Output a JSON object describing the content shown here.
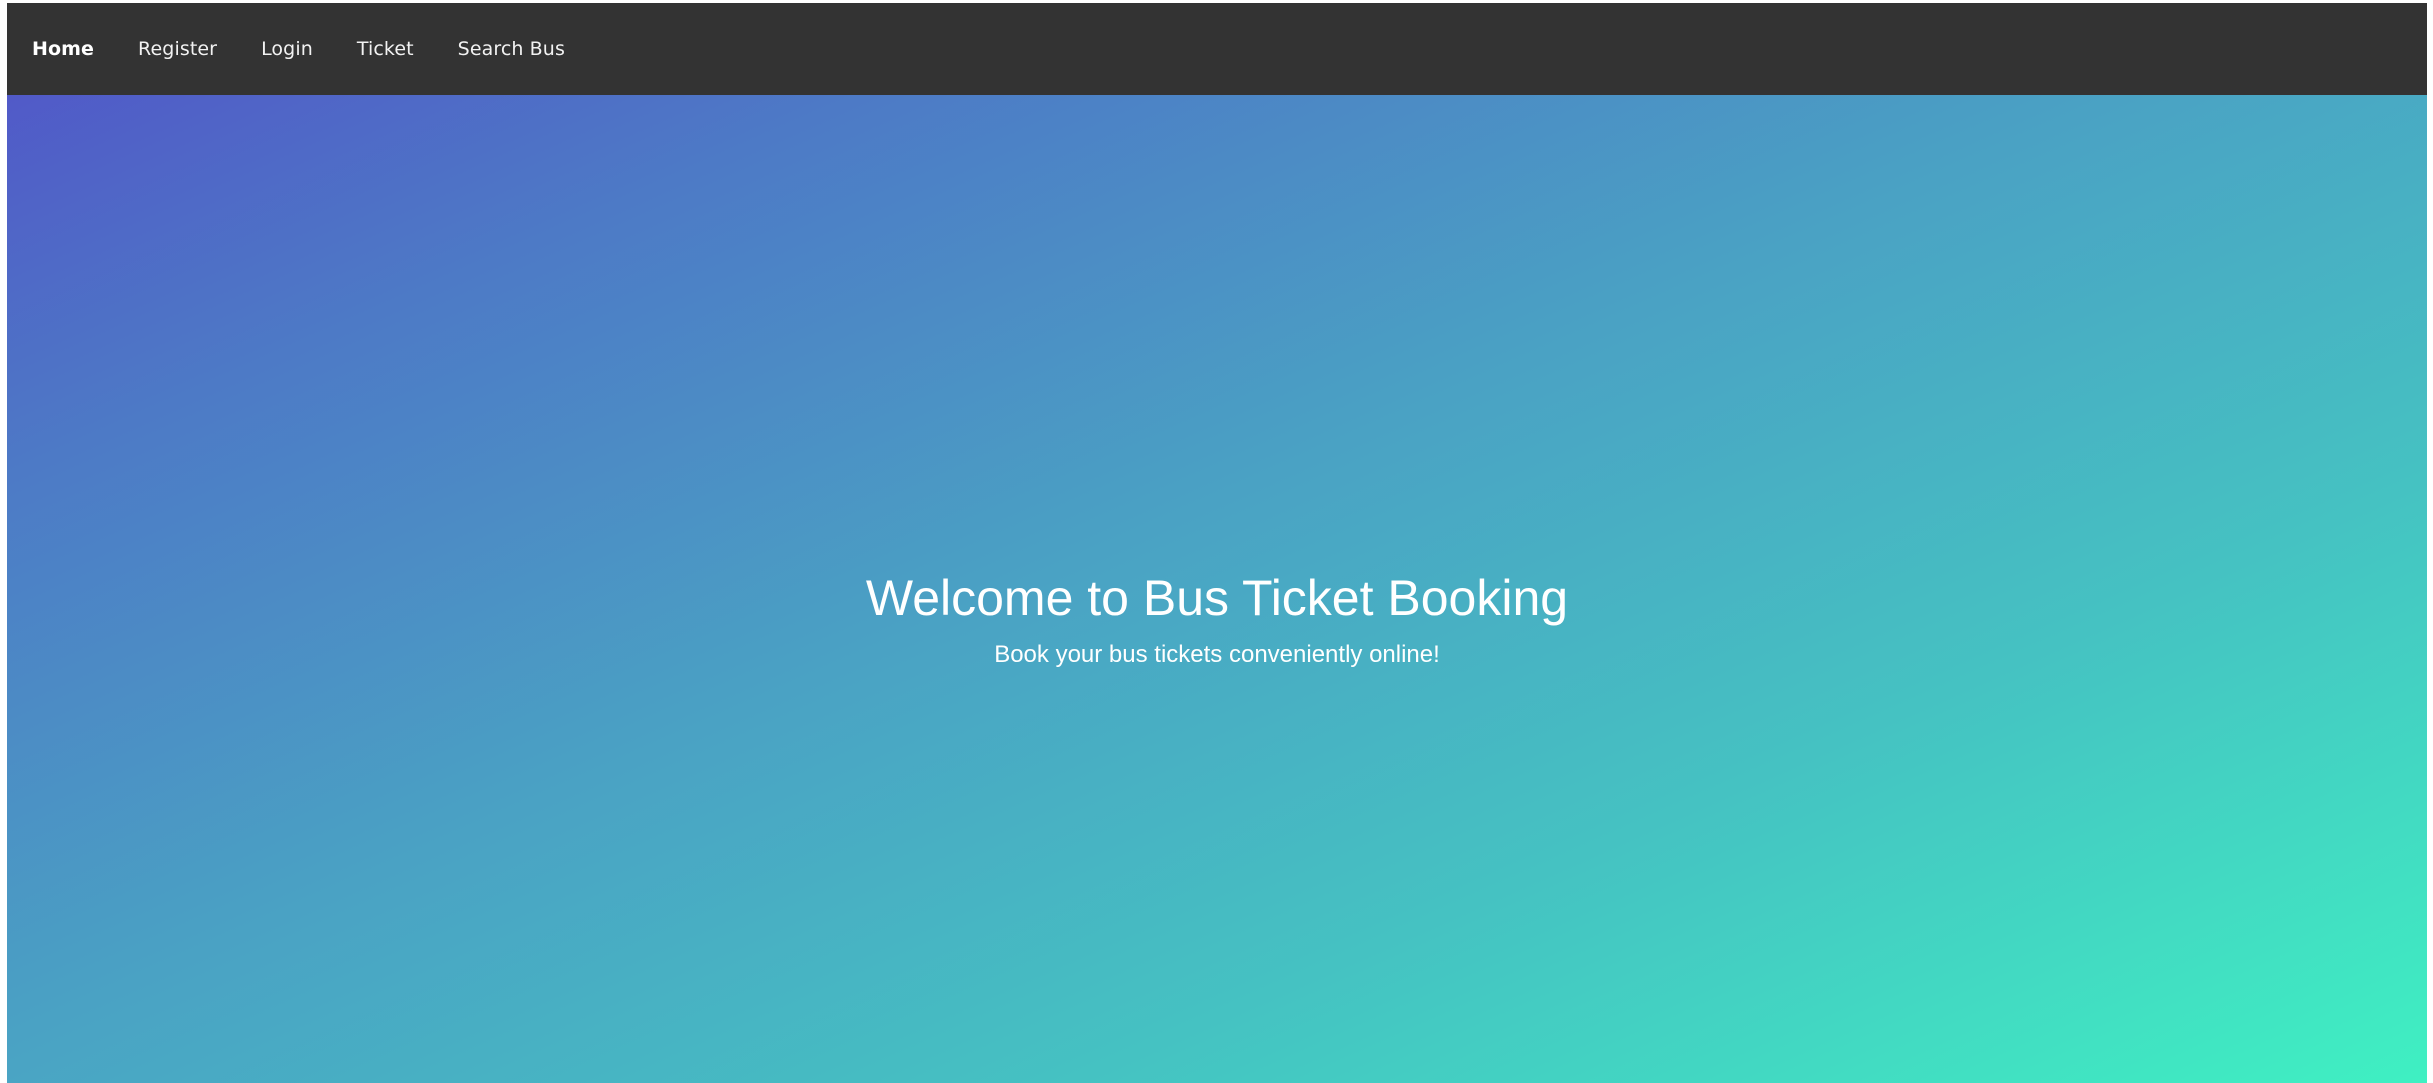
{
  "nav": {
    "items": [
      {
        "label": "Home",
        "active": true
      },
      {
        "label": "Register",
        "active": false
      },
      {
        "label": "Login",
        "active": false
      },
      {
        "label": "Ticket",
        "active": false
      },
      {
        "label": "Search Bus",
        "active": false
      }
    ]
  },
  "hero": {
    "title": "Welcome to Bus Ticket Booking",
    "subtitle": "Book your bus tickets conveniently online!"
  },
  "colors": {
    "navbar_bg": "#333333",
    "gradient_start": "#5252c8",
    "gradient_end": "#3ff0c2",
    "text": "#ffffff"
  }
}
